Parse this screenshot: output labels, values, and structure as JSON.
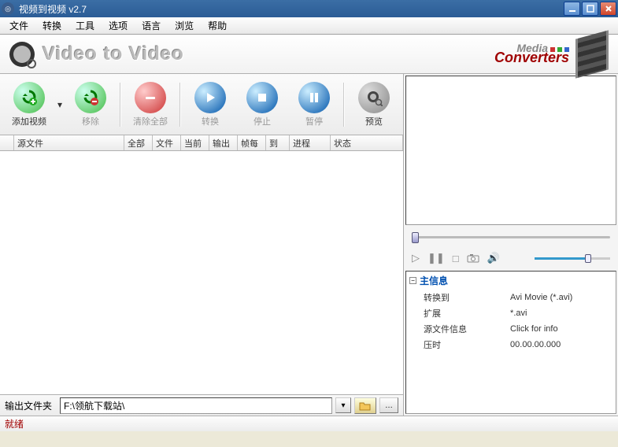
{
  "window": {
    "title": "视频到视频  v2.7"
  },
  "menu": [
    "文件",
    "转换",
    "工具",
    "选项",
    "语言",
    "浏览",
    "帮助"
  ],
  "banner": {
    "appname": "Video to Video",
    "brand1": "Media",
    "brand2": "Converters"
  },
  "toolbar": {
    "add": "添加视频",
    "remove": "移除",
    "clear": "清除全部",
    "convert": "转换",
    "stop": "停止",
    "pause": "暂停",
    "preview": "预览"
  },
  "columns": {
    "c0": "源文件",
    "c1": "全部",
    "c2": "文件",
    "c3": "当前",
    "c4": "输出",
    "c5": "帧每",
    "c6": "到",
    "c7": "进程",
    "c8": "状态"
  },
  "output": {
    "label": "输出文件夹",
    "path": "F:\\领航下载站\\"
  },
  "info": {
    "section": "主信息",
    "rows": [
      {
        "k": "转换到",
        "v": "Avi Movie (*.avi)"
      },
      {
        "k": "扩展",
        "v": "*.avi"
      },
      {
        "k": "源文件信息",
        "v": "Click for info"
      },
      {
        "k": "压时",
        "v": "00.00.00.000"
      }
    ]
  },
  "status": "就绪"
}
